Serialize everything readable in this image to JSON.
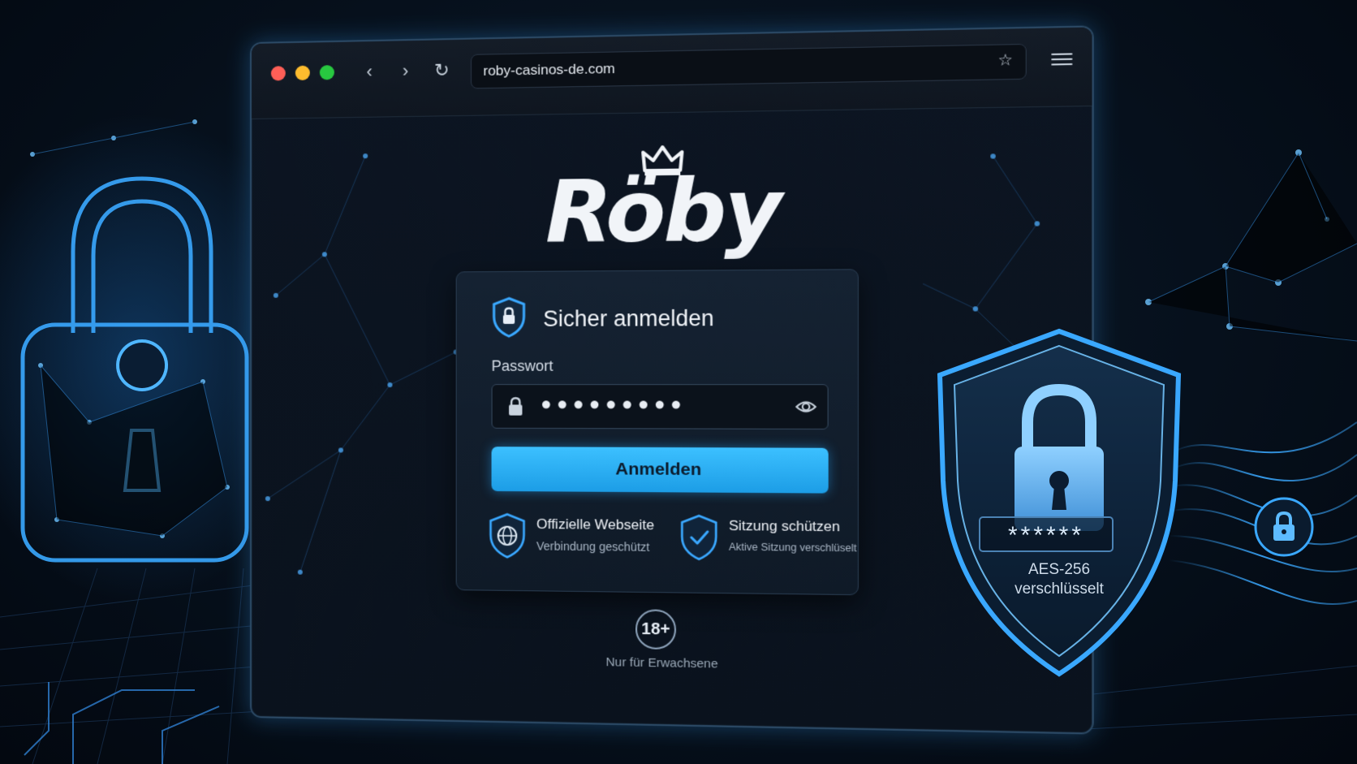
{
  "browser": {
    "url": "roby-casinos-de.com"
  },
  "brand": {
    "logo_text": "Röby"
  },
  "login": {
    "title": "Sicher anmelden",
    "password_label": "Passwort",
    "password_value": "●●●●●●●●●",
    "submit_label": "Anmelden"
  },
  "features": [
    {
      "title": "Offizielle Webseite",
      "subtitle": "Verbindung geschützt"
    },
    {
      "title": "Sitzung schützen",
      "subtitle": "Aktive Sitzung verschlüselt"
    }
  ],
  "age": {
    "badge": "18+",
    "note": "Nur für Erwachsene"
  },
  "security": {
    "masked": "******",
    "encryption_line1": "AES-256",
    "encryption_line2": "verschlüsselt"
  },
  "colors": {
    "accent": "#2bb0f5",
    "glow": "#3aa8ff",
    "background": "#06101c"
  }
}
